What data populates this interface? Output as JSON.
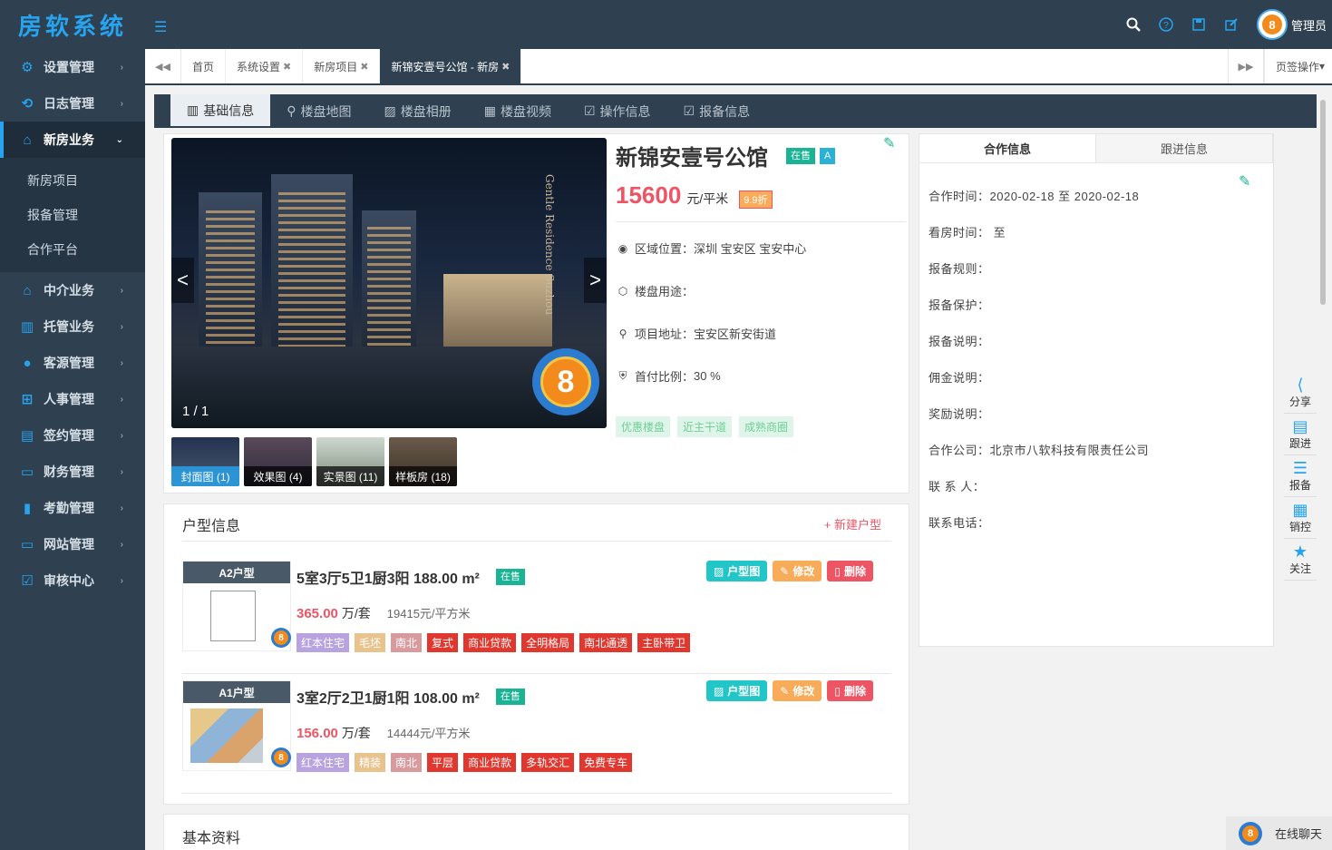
{
  "app": {
    "logo": "房软系统",
    "admin_label": "管理员",
    "avatar_number": "8"
  },
  "icons": {
    "menu": "menu-toggle-icon",
    "search": "search-icon",
    "help": "help-icon",
    "save": "save-icon",
    "edit": "edit-icon"
  },
  "sidebar": {
    "items": [
      {
        "label": "设置管理",
        "icon": "gear-icon"
      },
      {
        "label": "日志管理",
        "icon": "log-icon"
      },
      {
        "label": "新房业务",
        "icon": "home-icon",
        "active": true
      },
      {
        "label": "中介业务",
        "icon": "house-icon"
      },
      {
        "label": "托管业务",
        "icon": "building-icon"
      },
      {
        "label": "客源管理",
        "icon": "users-icon"
      },
      {
        "label": "人事管理",
        "icon": "org-icon"
      },
      {
        "label": "签约管理",
        "icon": "contract-icon"
      },
      {
        "label": "财务管理",
        "icon": "wallet-icon"
      },
      {
        "label": "考勤管理",
        "icon": "chart-icon"
      },
      {
        "label": "网站管理",
        "icon": "monitor-icon"
      },
      {
        "label": "审核中心",
        "icon": "check-icon"
      }
    ],
    "sub_items": [
      "新房项目",
      "报备管理",
      "合作平台"
    ]
  },
  "tabs": {
    "items": [
      {
        "label": "首页",
        "closable": false
      },
      {
        "label": "系统设置",
        "closable": true
      },
      {
        "label": "新房项目",
        "closable": true
      },
      {
        "label": "新锦安壹号公馆 - 新房",
        "closable": true,
        "active": true
      }
    ],
    "page_ops": "页签操作"
  },
  "section_tabs": [
    "基础信息",
    "楼盘地图",
    "楼盘相册",
    "楼盘视频",
    "操作信息",
    "报备信息"
  ],
  "project": {
    "title": "新锦安壹号公馆",
    "status_tag": "在售",
    "grade_tag": "A",
    "price": "15600",
    "price_unit": "元/平米",
    "discount": "9.9折",
    "hero_counter": "1 / 1",
    "hero_text": "Gentle Residence Suzhou",
    "region_label": "区域位置：",
    "region_value": "深圳 宝安区 宝安中心",
    "usage_label": "楼盘用途：",
    "usage_value": "",
    "address_label": "项目地址：",
    "address_value": "宝安区新安街道",
    "down_payment_label": "首付比例：",
    "down_payment_value": "30 %",
    "feature_tags": [
      "优惠楼盘",
      "近主干道",
      "成熟商圈"
    ],
    "thumbs": [
      "封面图 (1)",
      "效果图 (4)",
      "实景图 (11)",
      "样板房 (18)"
    ]
  },
  "cooperation": {
    "tabs": [
      "合作信息",
      "跟进信息"
    ],
    "rows": [
      {
        "label": "合作时间：",
        "value": "2020-02-18 至 2020-02-18"
      },
      {
        "label": "看房时间：",
        "value": "至"
      },
      {
        "label": "报备规则：",
        "value": ""
      },
      {
        "label": "报备保护：",
        "value": ""
      },
      {
        "label": "报备说明：",
        "value": ""
      },
      {
        "label": "佣金说明：",
        "value": ""
      },
      {
        "label": "奖励说明：",
        "value": ""
      },
      {
        "label": "合作公司：",
        "value": "北京市八软科技有限责任公司"
      },
      {
        "label": "联 系 人：",
        "value": ""
      },
      {
        "label": "联系电话：",
        "value": ""
      }
    ]
  },
  "units": {
    "header": "户型信息",
    "new_label": "+ 新建户型",
    "buttons": {
      "plan": "户型图",
      "edit": "修改",
      "delete": "删除"
    },
    "items": [
      {
        "name": "A2户型",
        "title": "5室3厅5卫1厨3阳 188.00 m²",
        "status": "在售",
        "price": "365.00",
        "price_unit": "万/套",
        "unit_price": "19415元/平方米",
        "tags": [
          {
            "text": "红本住宅",
            "color": "purple"
          },
          {
            "text": "毛坯",
            "color": "tan"
          },
          {
            "text": "南北",
            "color": "rose"
          },
          {
            "text": "复式",
            "color": "red"
          },
          {
            "text": "商业贷款",
            "color": "red"
          },
          {
            "text": "全明格局",
            "color": "red"
          },
          {
            "text": "南北通透",
            "color": "red"
          },
          {
            "text": "主卧带卫",
            "color": "red"
          }
        ]
      },
      {
        "name": "A1户型",
        "title": "3室2厅2卫1厨1阳 108.00 m²",
        "status": "在售",
        "price": "156.00",
        "price_unit": "万/套",
        "unit_price": "14444元/平方米",
        "tags": [
          {
            "text": "红本住宅",
            "color": "purple"
          },
          {
            "text": "精装",
            "color": "tan"
          },
          {
            "text": "南北",
            "color": "rose"
          },
          {
            "text": "平层",
            "color": "red"
          },
          {
            "text": "商业贷款",
            "color": "red"
          },
          {
            "text": "多轨交汇",
            "color": "red"
          },
          {
            "text": "免费专车",
            "color": "red"
          }
        ]
      }
    ]
  },
  "basic_info": {
    "header": "基本资料"
  },
  "float_bar": [
    "分享",
    "跟进",
    "报备",
    "销控",
    "关注"
  ],
  "chat": {
    "label": "在线聊天"
  },
  "colors": {
    "sidebar_bg": "#2f4050",
    "accent": "#27a4f0",
    "price_red": "#ed5565",
    "status_green": "#1ab394"
  }
}
